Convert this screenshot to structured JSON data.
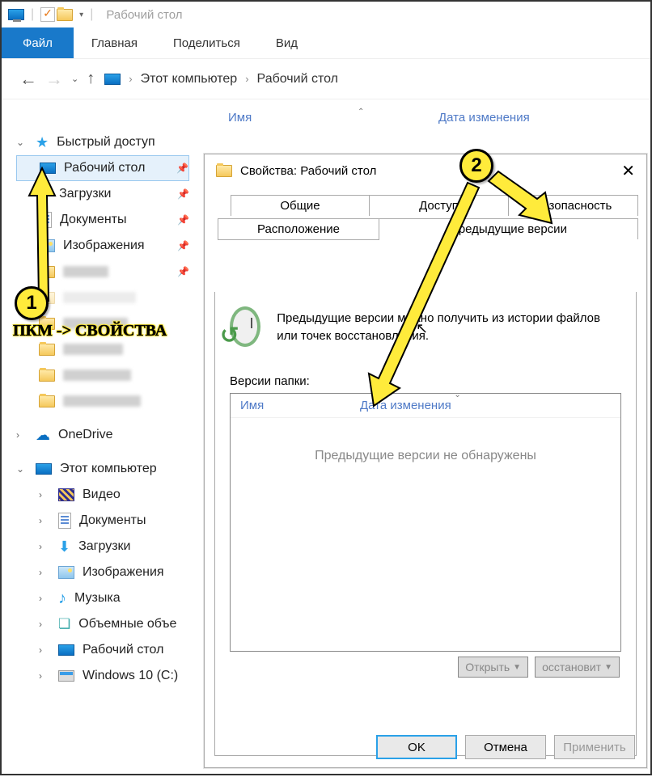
{
  "window": {
    "title_hint": "Рабочий стол"
  },
  "ribbon": {
    "file": "Файл",
    "tabs": [
      "Главная",
      "Поделиться",
      "Вид"
    ]
  },
  "breadcrumb": {
    "a": "Этот компьютер",
    "b": "Рабочий стол"
  },
  "cols": {
    "name": "Имя",
    "date": "Дата изменения"
  },
  "sidebar": {
    "quick": "Быстрый доступ",
    "quick_items": [
      {
        "label": "Рабочий стол"
      },
      {
        "label": "Загрузки"
      },
      {
        "label": "Документы"
      },
      {
        "label": "Изображения"
      }
    ],
    "onedrive": "OneDrive",
    "thispc": "Этот компьютер",
    "pc_items": [
      {
        "label": "Видео"
      },
      {
        "label": "Документы"
      },
      {
        "label": "Загрузки"
      },
      {
        "label": "Изображения"
      },
      {
        "label": "Музыка"
      },
      {
        "label": "Объемные объе"
      },
      {
        "label": "Рабочий стол"
      },
      {
        "label": "Windows 10 (C:)"
      }
    ]
  },
  "annotations": {
    "badge1": "1",
    "badge2": "2",
    "text": "ПКМ -> СВОЙСТВА"
  },
  "dialog": {
    "title": "Свойства: Рабочий стол",
    "tabs": {
      "general": "Общие",
      "share": "Доступ",
      "security": "Безопасность",
      "location": "Расположение",
      "prev": "Предыдущие версии"
    },
    "desc": "Предыдущие версии можно получить из истории файлов или точек восстановления.",
    "versions_label": "Версии папки:",
    "versions_cols": {
      "name": "Имя",
      "date": "Дата изменения"
    },
    "versions_empty": "Предыдущие версии не обнаружены",
    "btn_open": "Открыть",
    "btn_restore": "осстановит",
    "btn_ok": "OK",
    "btn_cancel": "Отмена",
    "btn_apply": "Применить"
  }
}
